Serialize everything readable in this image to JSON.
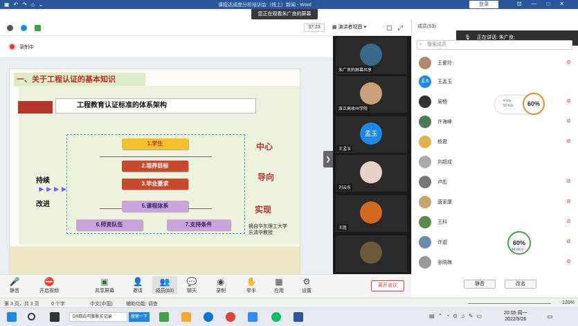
{
  "window": {
    "title": "课程达成度分析培训会（线上）新闻 - Word",
    "login_label": "登录",
    "share_banner": "您正在观看朱广良的屏幕"
  },
  "zoom_top": {
    "timer": "37:23",
    "view_label": "演讲者视图"
  },
  "recording": {
    "label": "录制中"
  },
  "slide": {
    "heading": "一、关于工程认证的基本知识",
    "frame_title": "工程教育认证标准的体系架构",
    "blocks": [
      "1.学生",
      "2.培养目标",
      "3.毕业要求",
      "5.课程体系",
      "6.师资队伍",
      "7.支持条件"
    ],
    "side_labels": [
      "中心",
      "导向",
      "实现"
    ],
    "continuous_top": "持续",
    "continuous_bottom": "改进",
    "credit_line1": "摘自华东理工大学",
    "credit_line2": "乐清华教授"
  },
  "video_tiles": [
    {
      "name": "朱广良的屏幕共享",
      "color": "#3a6a8a"
    },
    {
      "name": "淮正高收州学院",
      "color": "#c9a27a"
    },
    {
      "name": "王孟玉",
      "color": "#1e88e5",
      "avatar_text": "孟玉"
    },
    {
      "name": "刘云东",
      "color": "#e6d1c8"
    },
    {
      "name": "王胜",
      "color": "#d2691e"
    },
    {
      "name": "",
      "color": "#6b5a3a"
    }
  ],
  "participants": {
    "header": "成员(63)",
    "speaking": "正在讲话: 朱广良;",
    "search_placeholder": "搜索成员",
    "list": [
      {
        "name": "王爱玲",
        "color": "#b08968"
      },
      {
        "name": "王孟玉",
        "color": "#1e88e5",
        "initials": "孟玉"
      },
      {
        "name": "吴畅",
        "color": "#333333"
      },
      {
        "name": "许海峰",
        "color": "#4a7a5a"
      },
      {
        "name": "杨君",
        "color": "#e0b24a"
      },
      {
        "name": "刘超成",
        "color": "#aaaaaa"
      },
      {
        "name": "卢彪",
        "color": "#777777"
      },
      {
        "name": "唐家康",
        "color": "#c7a36d"
      },
      {
        "name": "王科",
        "color": "#5a8a4a"
      },
      {
        "name": "许迦",
        "color": "#6a8ab0"
      },
      {
        "name": "张晓梅",
        "color": "#999999"
      }
    ],
    "mute_label": "静音",
    "rename_label": "改名"
  },
  "net_widgets": [
    {
      "percent": "60%",
      "up": "4 K/s",
      "down": "50 K/s"
    },
    {
      "percent": "60%",
      "up": "0.5 K/s",
      "down": "44.6K/s"
    }
  ],
  "toolbar": {
    "items": [
      "静音",
      "开启视频",
      "共享屏幕",
      "邀请",
      "成员(63)",
      "聊天",
      "录制",
      "举手",
      "应用",
      "设置"
    ],
    "end_label": "离开会议"
  },
  "statusbar": {
    "page": "第 3 页，共 3 页",
    "words": "0 个字",
    "lang": "中文(中国)",
    "access": "辅助功能: 调查",
    "zoom": "120%"
  },
  "taskbar": {
    "task_label": "DR回应可膨胀买记录",
    "search_label": "搜索一下",
    "time": "20:05 周一",
    "date": "2022/9/26"
  }
}
